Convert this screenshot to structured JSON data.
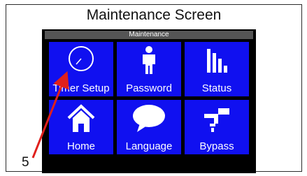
{
  "caption": "Maintenance Screen",
  "screen": {
    "title": "Maintenance",
    "tiles": [
      {
        "label": "Timer Setup",
        "icon": "clock-icon"
      },
      {
        "label": "Password",
        "icon": "user-icon"
      },
      {
        "label": "Status",
        "icon": "bar-chart-icon"
      },
      {
        "label": "Home",
        "icon": "home-icon"
      },
      {
        "label": "Language",
        "icon": "speech-bubble-icon"
      },
      {
        "label": "Bypass",
        "icon": "faucet-icon"
      }
    ]
  },
  "annotation": {
    "number": "5"
  },
  "colors": {
    "tile": "#1010f0",
    "arrow": "#e0201c",
    "titlebar": "#555555",
    "screen_bg": "#000000"
  }
}
